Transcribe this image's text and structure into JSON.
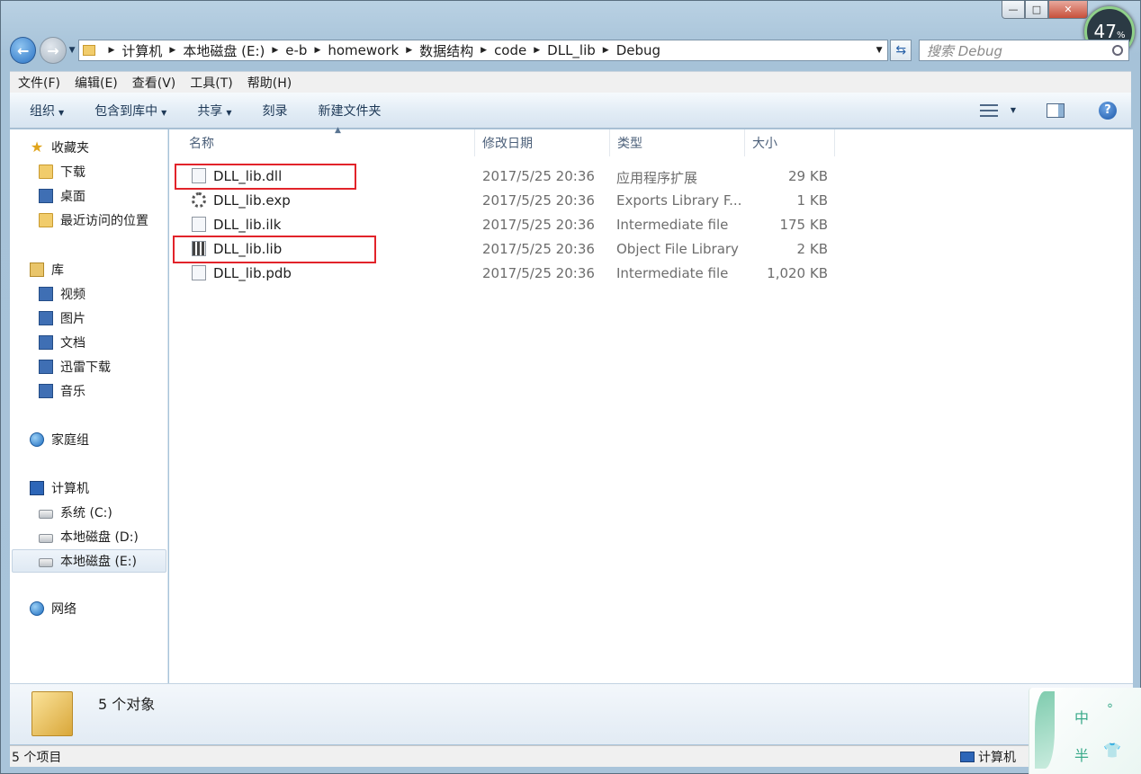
{
  "caption": {
    "min_label": "—",
    "max_label": "□",
    "close_label": "✕",
    "meter_value": "47",
    "meter_unit": "%"
  },
  "address": {
    "back_label": "←",
    "forward_label": "→",
    "crumbs": [
      "计算机",
      "本地磁盘 (E:)",
      "e-b",
      "homework",
      "数据结构",
      "code",
      "DLL_lib",
      "Debug"
    ],
    "search_placeholder": "搜索 Debug",
    "refresh_label": "⇆"
  },
  "menu": [
    "文件(F)",
    "编辑(E)",
    "查看(V)",
    "工具(T)",
    "帮助(H)"
  ],
  "toolbar": {
    "organize": "组织",
    "include": "包含到库中",
    "share": "共享",
    "burn": "刻录",
    "new_folder": "新建文件夹",
    "help_label": "?"
  },
  "nav": {
    "favorites": "收藏夹",
    "downloads": "下载",
    "desktop": "桌面",
    "recent": "最近访问的位置",
    "libraries": "库",
    "videos": "视频",
    "pictures": "图片",
    "documents": "文档",
    "xunlei": "迅雷下载",
    "music": "音乐",
    "homegroup": "家庭组",
    "computer": "计算机",
    "drive_c": "系统 (C:)",
    "drive_d": "本地磁盘 (D:)",
    "drive_e": "本地磁盘 (E:)",
    "network": "网络"
  },
  "columns": {
    "name": "名称",
    "date": "修改日期",
    "type": "类型",
    "size": "大小"
  },
  "files": [
    {
      "name": "DLL_lib.dll",
      "date": "2017/5/25 20:36",
      "type": "应用程序扩展",
      "size": "29 KB",
      "icon": "dll-file-icon",
      "highlighted": true
    },
    {
      "name": "DLL_lib.exp",
      "date": "2017/5/25 20:36",
      "type": "Exports Library F...",
      "size": "1 KB",
      "icon": "exp-file-icon",
      "highlighted": false
    },
    {
      "name": "DLL_lib.ilk",
      "date": "2017/5/25 20:36",
      "type": "Intermediate file",
      "size": "175 KB",
      "icon": "ilk-file-icon",
      "highlighted": false
    },
    {
      "name": "DLL_lib.lib",
      "date": "2017/5/25 20:36",
      "type": "Object File Library",
      "size": "2 KB",
      "icon": "lib-file-icon",
      "highlighted": true
    },
    {
      "name": "DLL_lib.pdb",
      "date": "2017/5/25 20:36",
      "type": "Intermediate file",
      "size": "1,020 KB",
      "icon": "pdb-file-icon",
      "highlighted": false
    }
  ],
  "details": {
    "object_count": "5 个对象"
  },
  "status": {
    "items": "5 个项目",
    "location": "计算机"
  },
  "ime": {
    "c1": "中",
    "c2": "°",
    "c3": "半",
    "c4": "👕"
  },
  "colors": {
    "highlight_box": "#e2232a",
    "accent": "#2a72c4"
  }
}
